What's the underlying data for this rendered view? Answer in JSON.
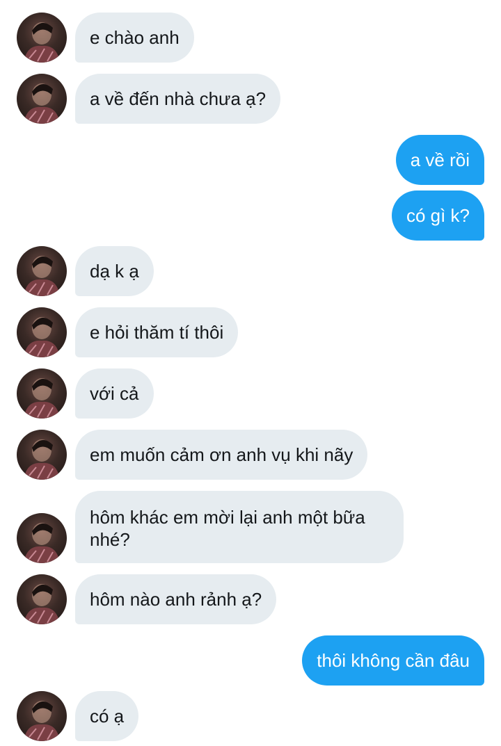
{
  "messages": [
    {
      "side": "in",
      "text": "e chào anh"
    },
    {
      "side": "in",
      "text": "a về đến nhà chưa ạ?"
    },
    {
      "side": "out",
      "text": "a về rồi"
    },
    {
      "side": "out",
      "text": "có gì k?"
    },
    {
      "side": "in",
      "text": "dạ k ạ"
    },
    {
      "side": "in",
      "text": "e hỏi thăm tí thôi"
    },
    {
      "side": "in",
      "text": "với cả"
    },
    {
      "side": "in",
      "text": "em muốn cảm ơn anh vụ khi nãy"
    },
    {
      "side": "in",
      "text": "hôm khác em mời lại anh một bữa nhé?"
    },
    {
      "side": "in",
      "text": "hôm nào anh rảnh ạ?"
    },
    {
      "side": "out",
      "text": "thôi không cần đâu"
    },
    {
      "side": "in",
      "text": "có ạ"
    }
  ],
  "colors": {
    "incoming_bubble": "#e6ecf0",
    "outgoing_bubble": "#1da1f2",
    "incoming_text": "#14171a",
    "outgoing_text": "#ffffff"
  },
  "icons": {
    "contact_avatar": "avatar-photo"
  }
}
